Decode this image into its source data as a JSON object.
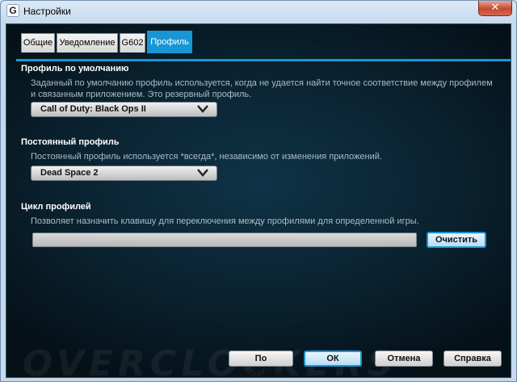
{
  "window": {
    "title": "Настройки",
    "logo_glyph": "G",
    "close_glyph": "✕"
  },
  "tabs": [
    {
      "label": "Общие",
      "active": false
    },
    {
      "label": "Уведомление",
      "active": false
    },
    {
      "label": "G602",
      "active": false
    },
    {
      "label": "Профиль",
      "active": true
    }
  ],
  "sections": {
    "default_profile": {
      "title": "Профиль по умолчанию",
      "description": "Заданный по умолчанию профиль используется, когда не удается найти точное соответствие между профилем и связанным приложением. Это резервный профиль.",
      "selected": "Call of Duty: Black Ops II"
    },
    "persistent_profile": {
      "title": "Постоянный профиль",
      "description": "Постоянный профиль используется *всегда*, независимо от изменения приложений.",
      "selected": "Dead Space 2"
    },
    "profile_cycle": {
      "title": "Цикл профилей",
      "description": "Позволяет назначить клавишу для переключения между профилями для определенной игры.",
      "key_value": "",
      "clear_label": "Очистить"
    }
  },
  "footer": {
    "defaults_label": "По умолчанию",
    "ok_label": "ОК",
    "cancel_label": "Отмена",
    "help_label": "Справка"
  },
  "watermark": "OVERCLOCKERS",
  "colors": {
    "accent": "#1796d4",
    "background": "#0a2230"
  },
  "icons": {
    "dropdown": "chevron-down-icon",
    "app": "logitech-logo-icon",
    "close": "close-icon"
  }
}
